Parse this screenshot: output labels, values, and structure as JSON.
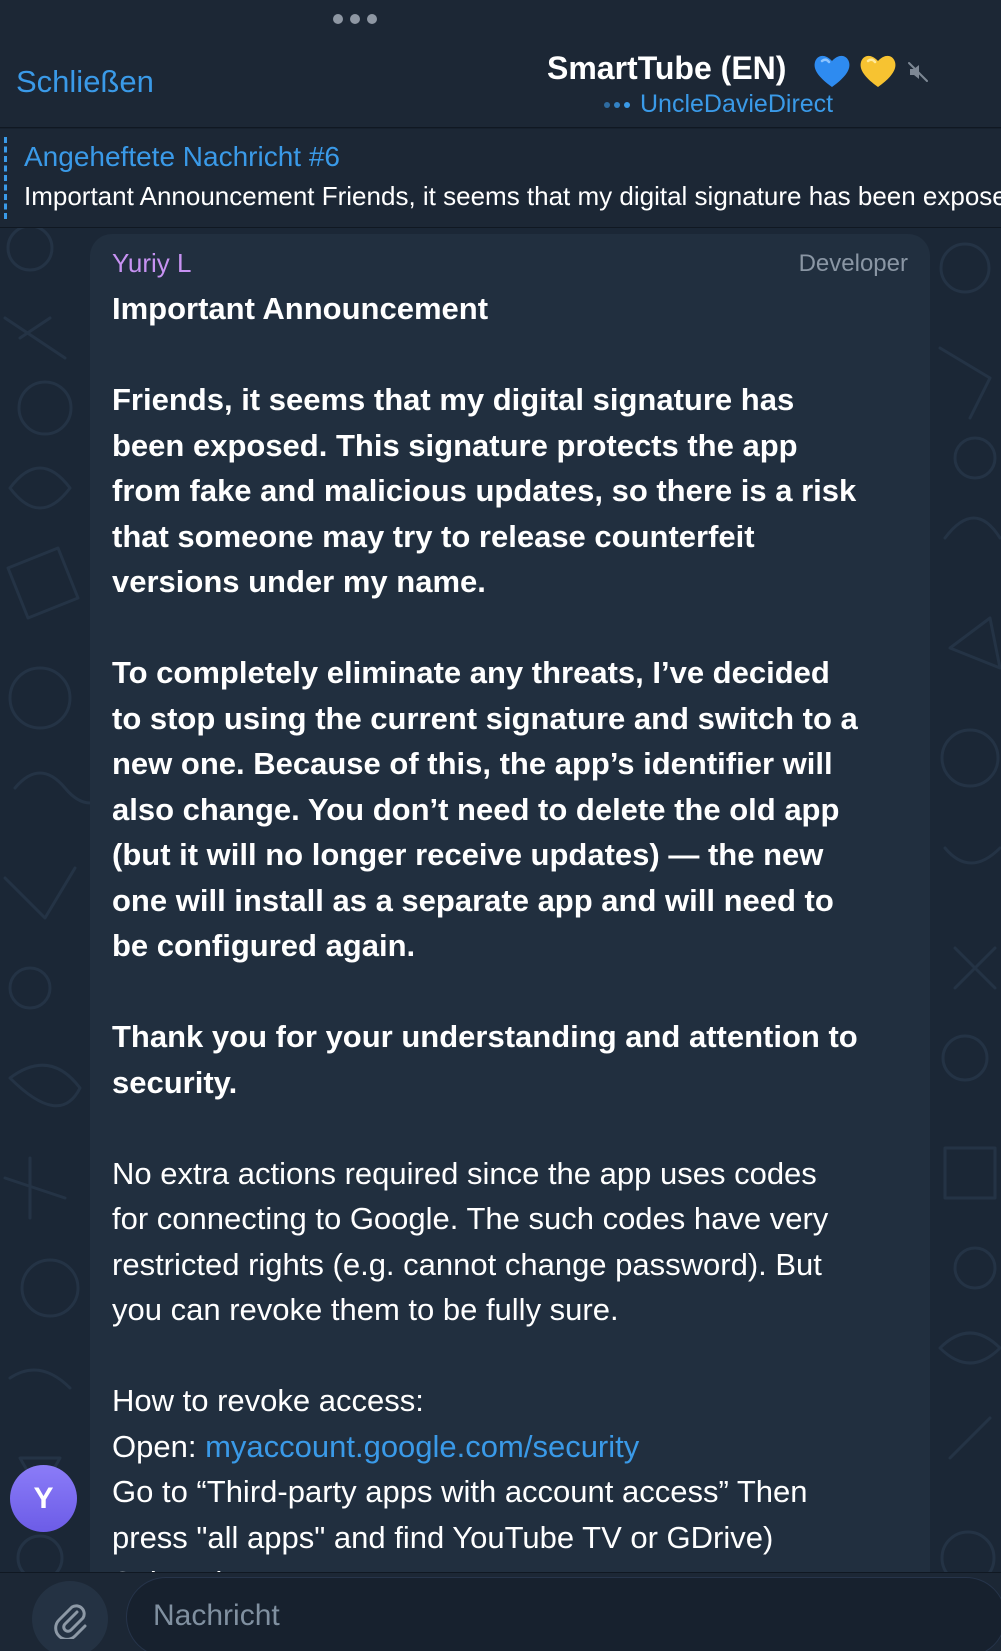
{
  "header": {
    "close_label": "Schließen",
    "title": "SmartTube (EN)",
    "subtitle": "UncleDavieDirect",
    "hearts": [
      "blue-heart",
      "yellow-heart"
    ],
    "muted_icon": "speaker-muted-icon"
  },
  "pinned": {
    "title": "Angeheftete Nachricht #6",
    "text": "Important Announcement Friends, it seems that my digital signature has been exposed."
  },
  "message": {
    "sender": "Yuriy L",
    "role": "Developer",
    "heading": "Important Announcement",
    "para1_lines": [
      "Friends, it seems that my digital signature has",
      "been exposed. This signature protects the app",
      "from fake and malicious updates, so there is a risk",
      "that someone may try to release counterfeit",
      "versions under my name."
    ],
    "para2_lines": [
      "To completely eliminate any threats, I’ve decided",
      "to stop using the current signature and switch to a",
      "new one. Because of this, the app’s identifier will",
      "also change. You don’t need to delete the old app",
      "(but it will no longer receive updates) — the new",
      "one will install as a separate app and will need to",
      "be configured again."
    ],
    "para3_lines": [
      "Thank you for your understanding and attention to",
      "security."
    ],
    "para4_lines": [
      "No extra actions required since the app uses codes",
      "for connecting to Google. The such codes have very",
      "restricted rights (e.g. cannot change password). But",
      "you can revoke them to be fully sure."
    ],
    "howto_title": "How to revoke access:",
    "open_label": "Open: ",
    "open_link": "myaccount.google.com/security",
    "step_lines": [
      "Go to “Third-party apps with account access” Then",
      "press \"all apps\" and find YouTube TV or GDrive)",
      "Select the app → “Remove access”"
    ]
  },
  "avatar": {
    "initial": "Y"
  },
  "composer": {
    "placeholder": "Nachricht"
  },
  "colors": {
    "accent": "#3a9ae8",
    "sender": "#c792f2",
    "bubble": "#212f3f",
    "background": "#1b2736"
  }
}
